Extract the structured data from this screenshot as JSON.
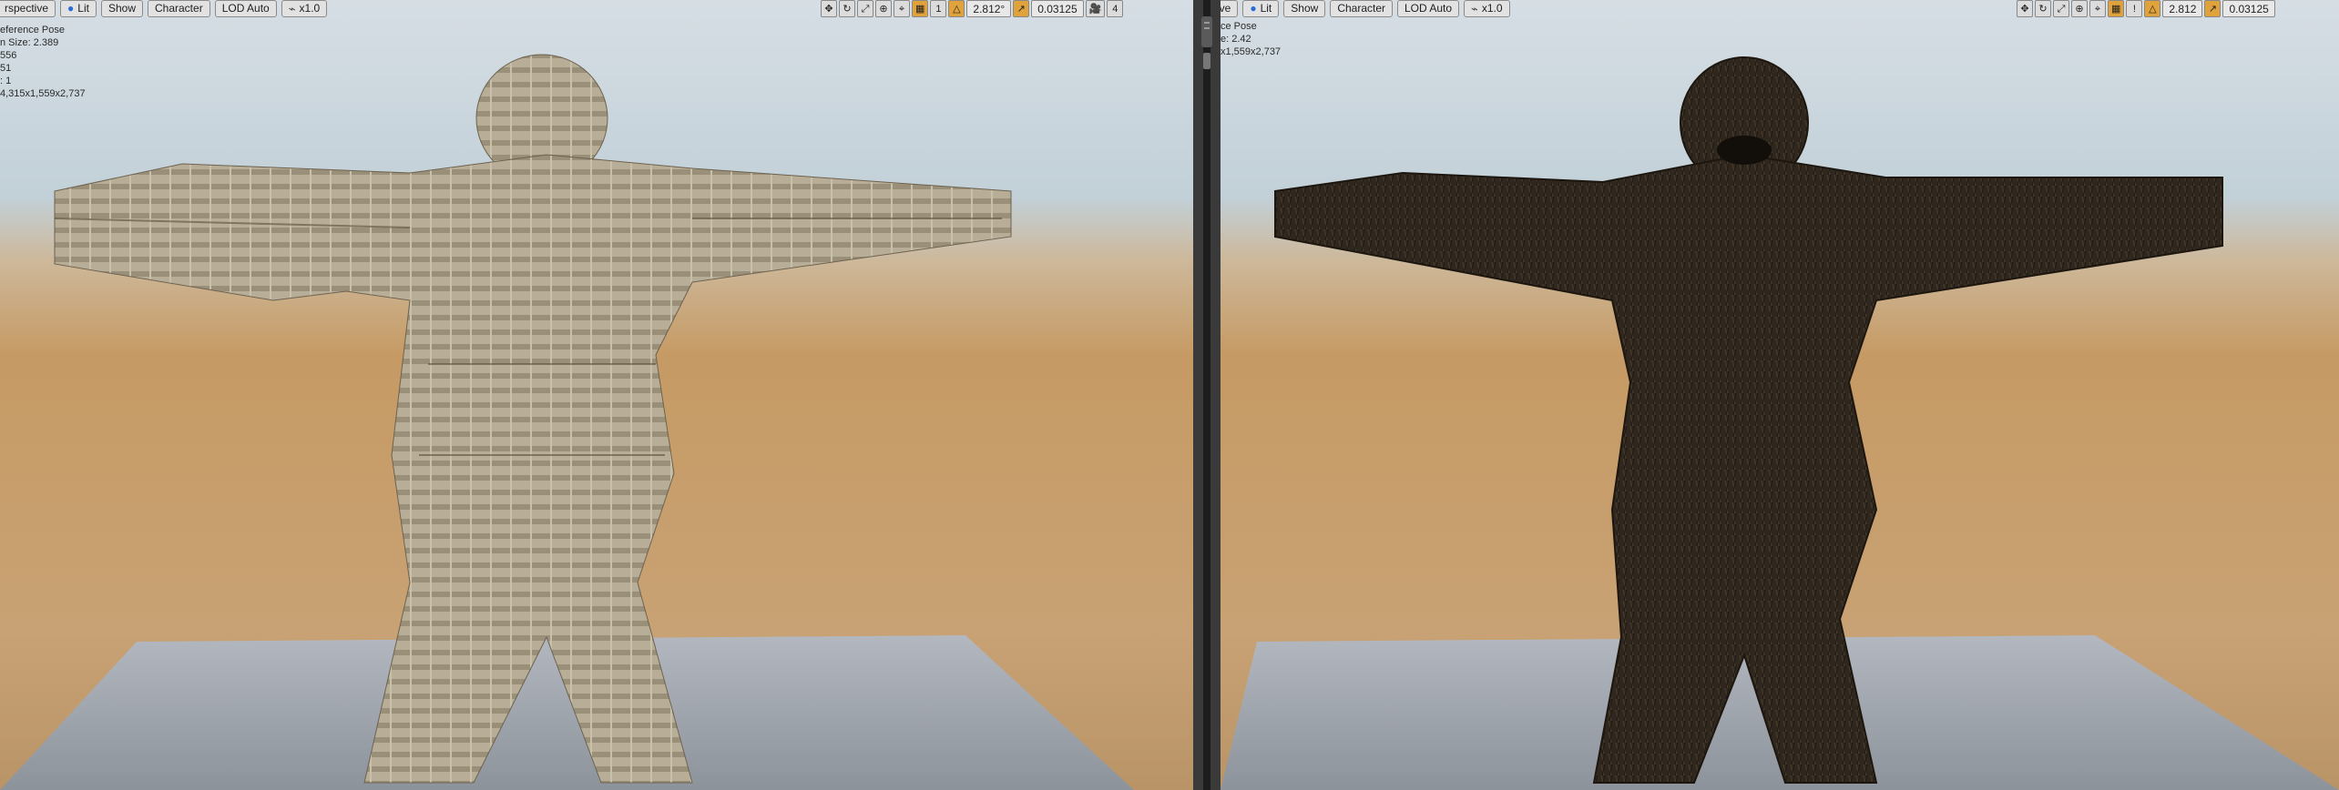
{
  "left_viewport": {
    "toolbar": {
      "view_mode": "rspective",
      "lit": "Lit",
      "show": "Show",
      "character": "Character",
      "lod": "LOD Auto",
      "speed": "x1.0"
    },
    "right_tools": {
      "snap_count": "1",
      "angle": "2.812°",
      "scale": "0.03125",
      "camera_speed": "4"
    },
    "info_lines": [
      "eference Pose",
      "",
      "n Size: 2.389",
      "556",
      "51",
      ": 1",
      "4,315x1,559x2,737"
    ]
  },
  "right_viewport": {
    "toolbar": {
      "view_mode": "ive",
      "lit": "Lit",
      "show": "Show",
      "character": "Character",
      "lod": "LOD Auto",
      "speed": "x1.0"
    },
    "right_tools": {
      "angle": "2.812",
      "scale": "0.03125"
    },
    "info_lines": [
      "ce Pose",
      "",
      "e: 2.42",
      "",
      "",
      "",
      "x1,559x2,737"
    ]
  },
  "colors": {
    "sky_top": "#c9d6de",
    "desert": "#c9a172",
    "floor": "#9aa0a8",
    "fur_light": "#b3a891",
    "fur_dark": "#2f271d"
  },
  "icons": [
    "lit-sphere-icon",
    "move-icon",
    "rotate-icon",
    "scale-icon",
    "globe-icon",
    "grid-snap-icon",
    "angle-snap-icon",
    "scale-snap-icon",
    "camera-speed-icon",
    "speed-icon"
  ]
}
